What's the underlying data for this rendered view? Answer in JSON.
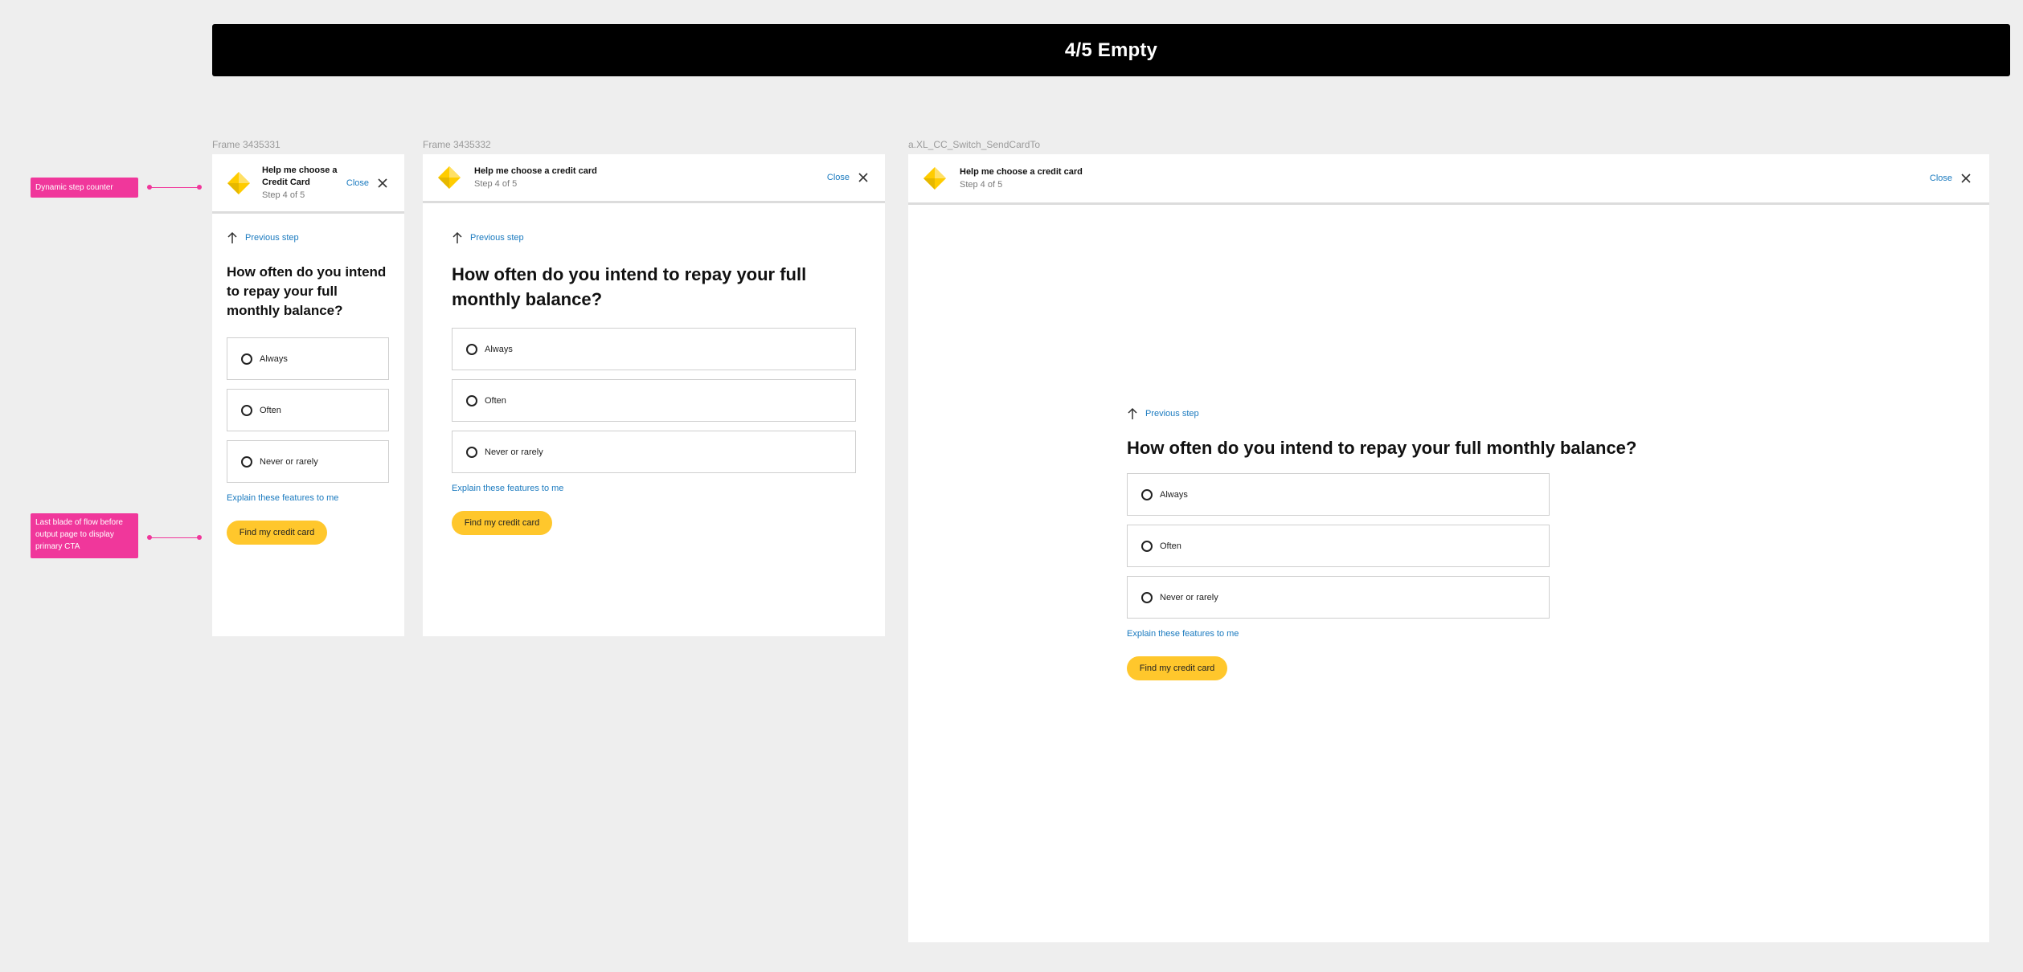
{
  "banner": {
    "title": "4/5 Empty"
  },
  "frames": [
    {
      "label": "Frame 3435331",
      "header": {
        "title": "Help me choose a Credit Card",
        "step": "Step 4 of 5",
        "close": "Close"
      },
      "prev": "Previous step",
      "question": "How often do you intend to repay your full monthly balance?",
      "options": [
        "Always",
        "Often",
        "Never or rarely"
      ],
      "explain": "Explain these features to me",
      "cta": "Find my credit card"
    },
    {
      "label": "Frame 3435332",
      "header": {
        "title": "Help me choose a credit card",
        "step": "Step 4 of 5",
        "close": "Close"
      },
      "prev": "Previous step",
      "question": "How often do you intend to repay your full monthly balance?",
      "options": [
        "Always",
        "Often",
        "Never or rarely"
      ],
      "explain": "Explain these features to me",
      "cta": "Find my credit card"
    },
    {
      "label": "a.XL_CC_Switch_SendCardTo",
      "header": {
        "title": "Help me choose a credit card",
        "step": "Step 4 of 5",
        "close": "Close"
      },
      "prev": "Previous step",
      "question": "How often do you intend to repay your full monthly balance?",
      "options": [
        "Always",
        "Often",
        "Never or rarely"
      ],
      "explain": "Explain these features to me",
      "cta": "Find my credit card"
    }
  ],
  "annotations": [
    "Dynamic step counter",
    "Last blade of flow before output page to display primary CTA"
  ],
  "colors": {
    "accent_link": "#1a7abf",
    "cta_yellow": "#ffc72c",
    "annotation_pink": "#f0379b",
    "logo_yellow": "#ffcc00"
  },
  "icons": [
    "diamond-logo-icon",
    "close-icon",
    "arrow-up-icon",
    "radio-icon"
  ]
}
